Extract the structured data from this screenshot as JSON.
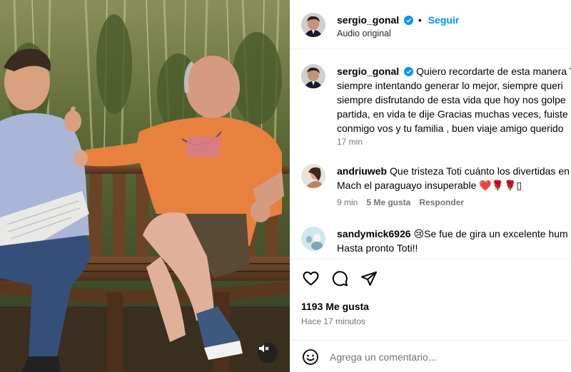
{
  "post": {
    "author": "sergio_gonal",
    "follow_label": "Seguir",
    "separator": "•",
    "audio_label": "Audio original",
    "verified_color": "#0095f6"
  },
  "comments": [
    {
      "username": "sergio_gonal",
      "verified": true,
      "lines": [
        "Quiero recordarte de esta manera T",
        "siempre intentando generar lo mejor, siempre queri",
        "siempre disfrutando de esta vida que hoy nos golpe",
        "partida, en vida te dije Gracias muchas veces, fuiste",
        "conmigo vos y tu familia , buen viaje amigo querido"
      ],
      "time": "17 min"
    },
    {
      "username": "andriuweb",
      "lines": [
        "Que tristeza Toti cuánto los divertidas en",
        "Mach el paraguayo insuperable ❤️🌹🌹▯"
      ],
      "time": "9 min",
      "likes": "5 Me gusta",
      "reply": "Responder"
    },
    {
      "username": "sandymick6926",
      "lines": [
        "😢Se fue de gira un excelente hum",
        "Hasta pronto Toti!!"
      ]
    }
  ],
  "actions": {
    "icons": [
      "heart-icon",
      "comment-icon",
      "share-icon"
    ],
    "likes_count": "1193 Me gusta",
    "time_ago": "Hace 17 minutos"
  },
  "add_comment": {
    "placeholder": "Agrega un comentario..."
  },
  "media": {
    "mute_icon": "speaker-muted-icon"
  }
}
